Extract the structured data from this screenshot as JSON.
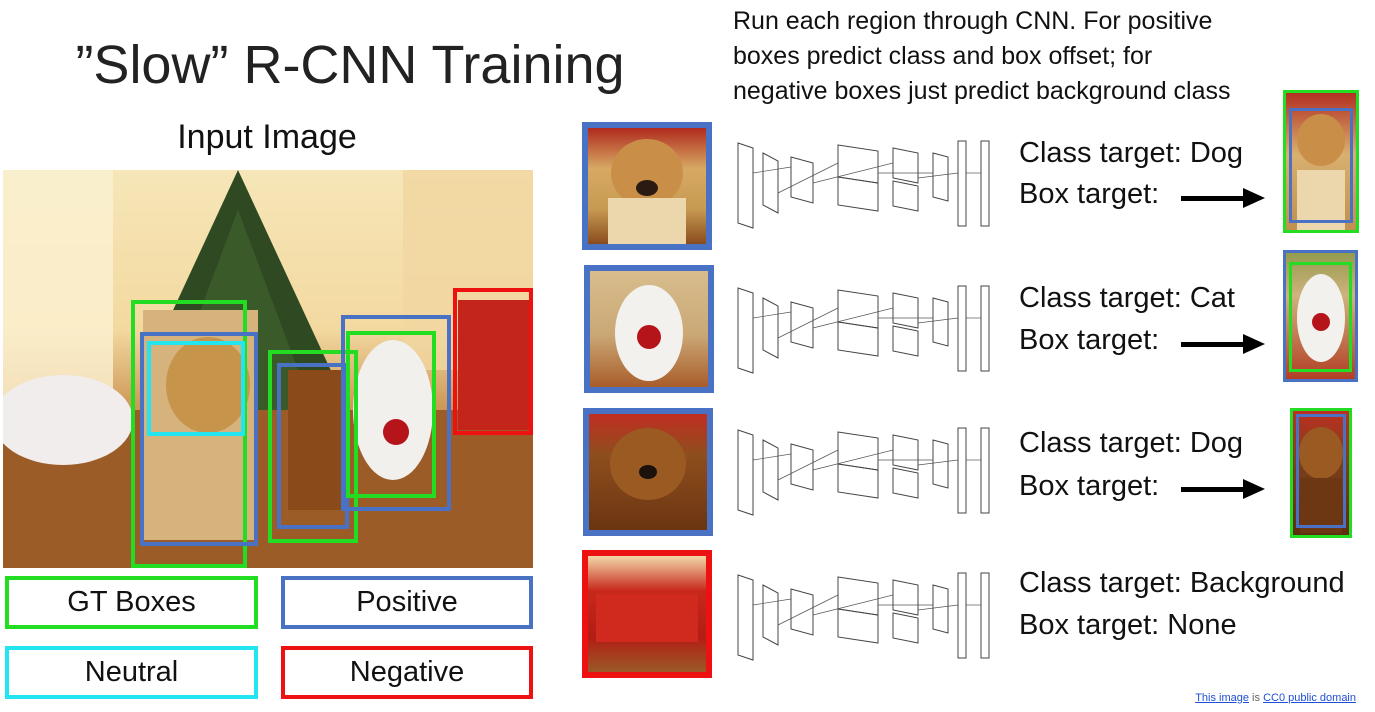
{
  "title": "”Slow” R-CNN Training",
  "input_title": "Input Image",
  "header_lines": [
    "Run each region through CNN. For positive",
    "boxes predict class and box offset; for",
    "negative boxes just predict background class"
  ],
  "legend": {
    "gt": "GT Boxes",
    "positive": "Positive",
    "neutral": "Neutral",
    "negative": "Negative"
  },
  "colors": {
    "gt": "#22dd22",
    "positive": "#4a72c4",
    "neutral": "#22e5f0",
    "negative": "#ee1111"
  },
  "rows": [
    {
      "class_target": "Class target: Dog",
      "box_target": "Box target:",
      "has_arrow": true
    },
    {
      "class_target": "Class target: Cat",
      "box_target": "Box target:",
      "has_arrow": true
    },
    {
      "class_target": "Class target: Dog",
      "box_target": "Box target:",
      "has_arrow": true
    },
    {
      "class_target": "Class target: Background",
      "box_target": "Box target: None",
      "has_arrow": false
    }
  ],
  "credit": {
    "link1": "This image",
    "mid": "is",
    "link2": "CC0 public domain"
  }
}
